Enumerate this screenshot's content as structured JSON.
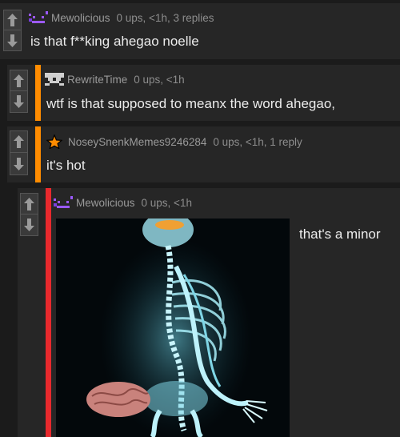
{
  "comments": [
    {
      "username": "Mewolicious",
      "meta": "0 ups, <1h, 3 replies",
      "text": "is that f**king ahegao noelle"
    },
    {
      "username": "RewriteTime",
      "meta": "0 ups, <1h",
      "text": "wtf is that supposed to meanx the word ahegao,"
    },
    {
      "username": "NoseySnenkMemes9246284",
      "meta": "0 ups, <1h, 1 reply",
      "text": "it's hot"
    },
    {
      "username": "Mewolicious",
      "meta": "0 ups, <1h",
      "text": "that's a minor"
    }
  ],
  "colors": {
    "accent_orange": "#ff8c00",
    "accent_red": "#e8292d",
    "avatar_purple": "#9b59ff"
  }
}
